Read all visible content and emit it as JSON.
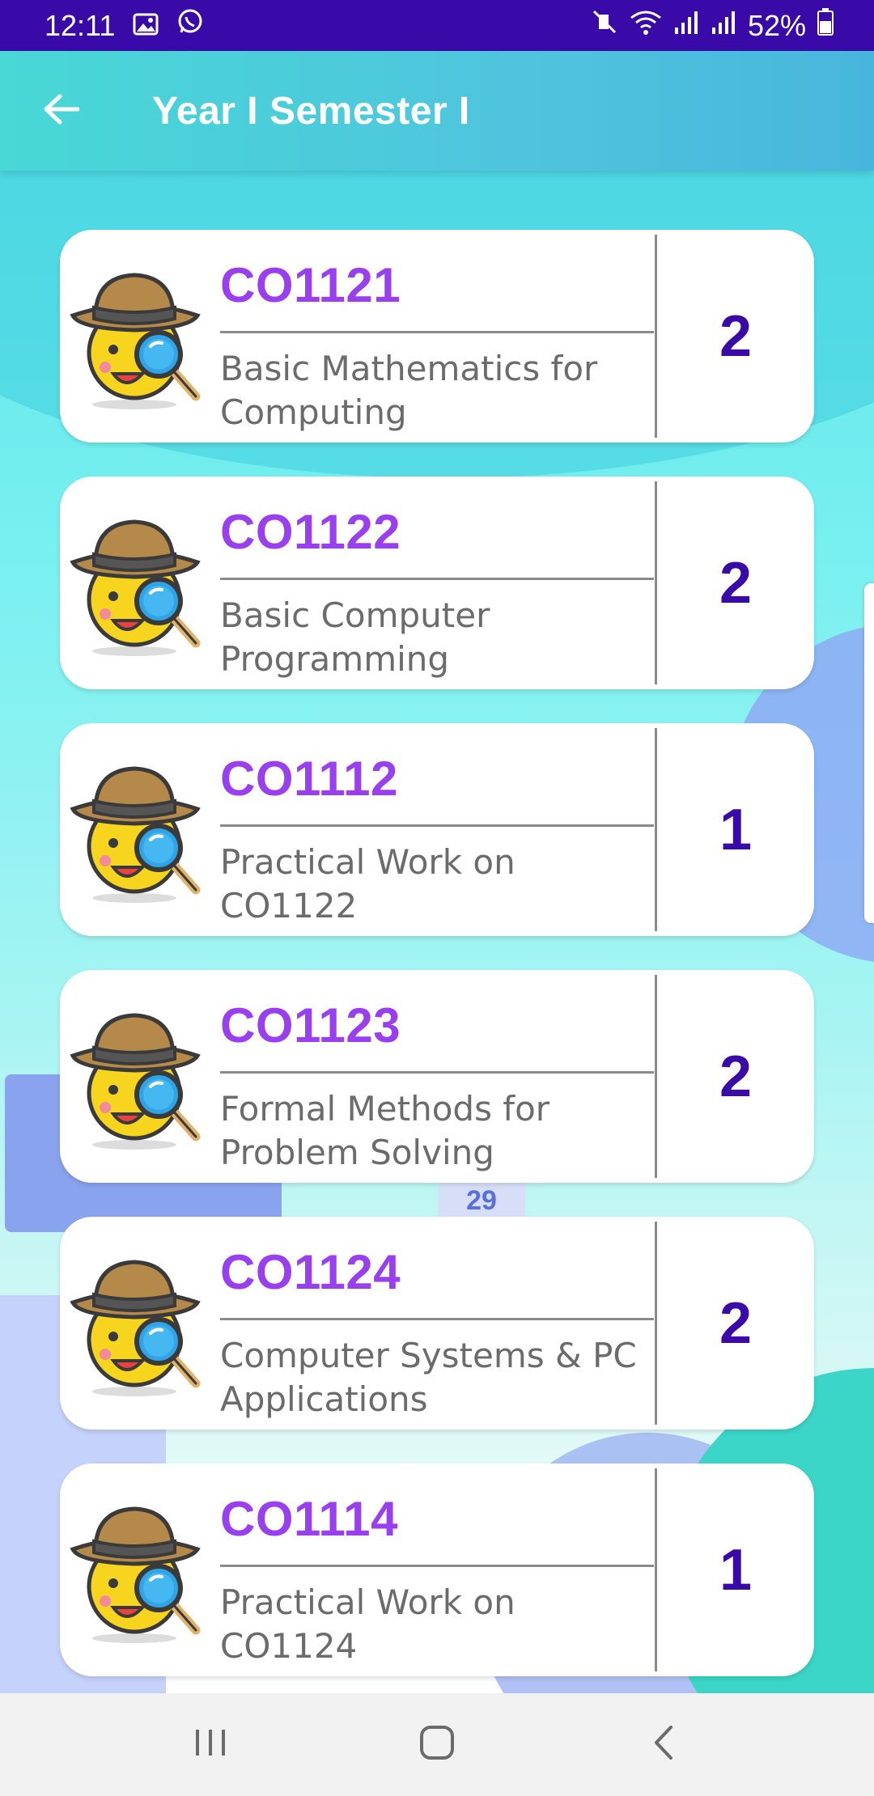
{
  "status_bar": {
    "time": "12:11",
    "battery": "52%",
    "icons": [
      "image-icon",
      "whatsapp-icon",
      "mute-icon",
      "wifi-icon",
      "signal-icon",
      "signal-icon",
      "battery-icon"
    ]
  },
  "app_bar": {
    "title": "Year I Semester I",
    "back_icon": "arrow-left-icon"
  },
  "background": {
    "calendar_day": "29"
  },
  "courses": [
    {
      "code": "CO1121",
      "name": "Basic Mathematics for Computing",
      "credits": "2"
    },
    {
      "code": "CO1122",
      "name": "Basic Computer Programming",
      "credits": "2"
    },
    {
      "code": "CO1112",
      "name": "Practical Work on CO1122",
      "credits": "1"
    },
    {
      "code": "CO1123",
      "name": "Formal Methods for Problem Solving",
      "credits": "2"
    },
    {
      "code": "CO1124",
      "name": "Computer Systems & PC Applications",
      "credits": "2"
    },
    {
      "code": "CO1114",
      "name": "Practical Work on CO1124",
      "credits": "1"
    }
  ],
  "nav_bar": {
    "icons": [
      "recent-apps-icon",
      "home-icon",
      "back-icon"
    ]
  },
  "colors": {
    "status_bar": "#3a0aa8",
    "app_bar": "#4fc4de",
    "course_code": "#9a3ff0",
    "credits": "#3a0aa8",
    "course_name": "#6b6b6b"
  }
}
